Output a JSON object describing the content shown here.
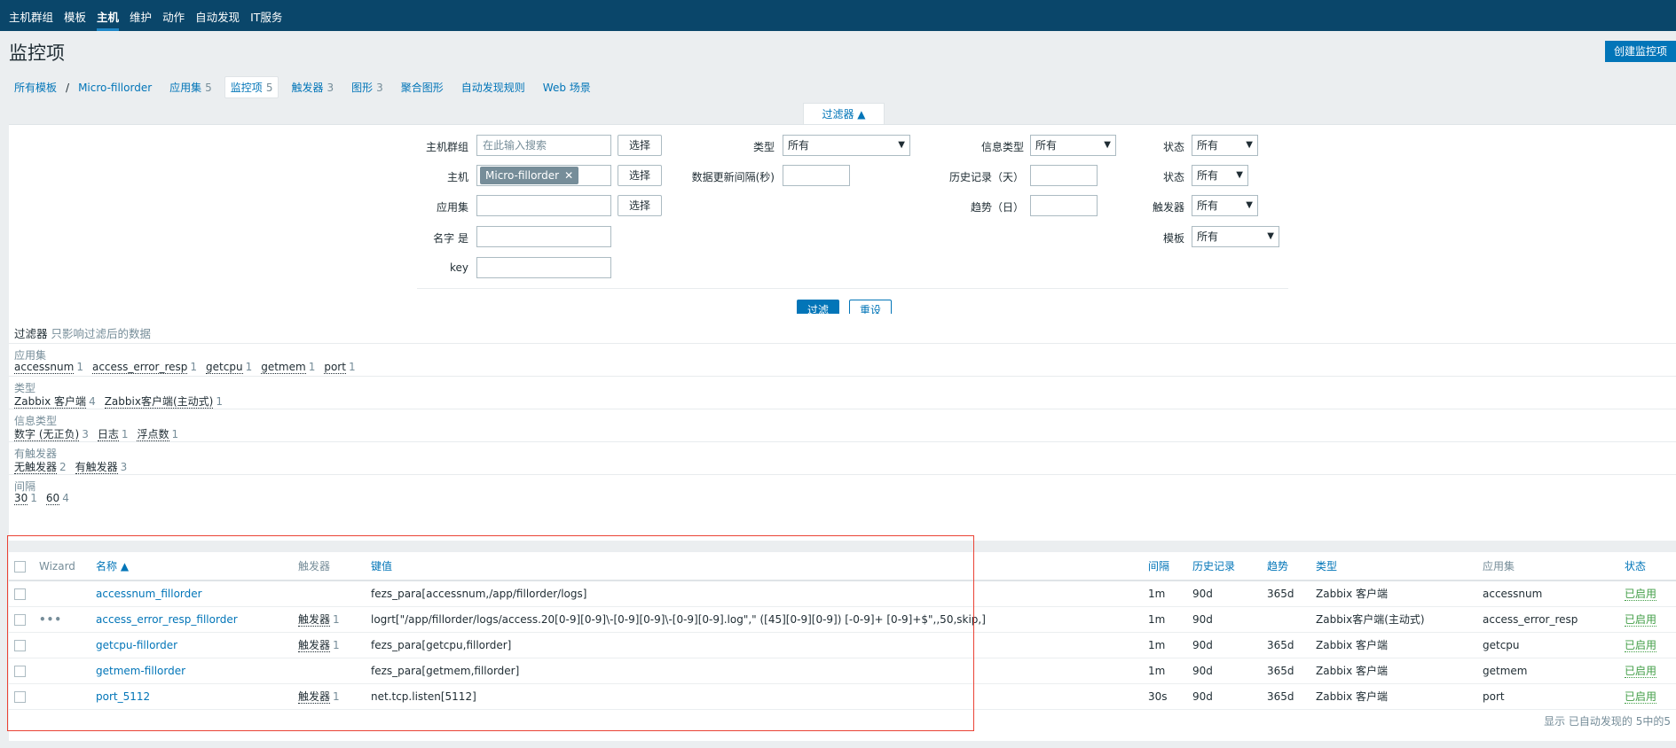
{
  "nav": {
    "tabs": [
      "主机群组",
      "模板",
      "主机",
      "维护",
      "动作",
      "自动发现",
      "IT服务"
    ],
    "active": 2
  },
  "header": {
    "title": "监控项",
    "create_button": "创建监控项"
  },
  "breadcrumbs": [
    {
      "label": "所有模板",
      "count": ""
    },
    {
      "label": "Micro-fillorder",
      "count": ""
    },
    {
      "label": "应用集",
      "count": "5"
    },
    {
      "label": "监控项",
      "count": "5"
    },
    {
      "label": "触发器",
      "count": "3"
    },
    {
      "label": "图形",
      "count": "3"
    },
    {
      "label": "聚合图形",
      "count": ""
    },
    {
      "label": "自动发现规则",
      "count": ""
    },
    {
      "label": "Web 场景",
      "count": ""
    }
  ],
  "filter": {
    "tab_label": "过滤器 ▲",
    "host_group_label": "主机群组",
    "host_group_placeholder": "在此输入搜索",
    "select_button": "选择",
    "host_label": "主机",
    "host_tag": "Micro-fillorder",
    "app_label": "应用集",
    "name_label": "名字 是",
    "key_label": "key",
    "type_label": "类型",
    "type_value": "所有",
    "update_interval_label": "数据更新间隔(秒)",
    "info_type_label": "信息类型",
    "info_type_value": "所有",
    "history_label": "历史记录（天）",
    "trends_label": "趋势（日）",
    "state_label": "状态",
    "state_value": "所有",
    "status_label": "状态",
    "status_value": "所有",
    "triggers_label": "触发器",
    "triggers_value": "所有",
    "template_label": "模板",
    "template_value": "所有",
    "apply_button": "过滤",
    "reset_button": "重设"
  },
  "subfilter": {
    "title": "过滤器",
    "note": "只影响过滤后的数据",
    "groups": [
      {
        "header": "应用集",
        "values": [
          {
            "t": "accessnum",
            "n": "1"
          },
          {
            "t": "access_error_resp",
            "n": "1"
          },
          {
            "t": "getcpu",
            "n": "1"
          },
          {
            "t": "getmem",
            "n": "1"
          },
          {
            "t": "port",
            "n": "1"
          }
        ]
      },
      {
        "header": "类型",
        "values": [
          {
            "t": "Zabbix 客户端",
            "n": "4"
          },
          {
            "t": "Zabbix客户端(主动式)",
            "n": "1"
          }
        ]
      },
      {
        "header": "信息类型",
        "values": [
          {
            "t": "数字 (无正负)",
            "n": "3"
          },
          {
            "t": "日志",
            "n": "1"
          },
          {
            "t": "浮点数",
            "n": "1"
          }
        ]
      },
      {
        "header": "有触发器",
        "values": [
          {
            "t": "无触发器",
            "n": "2"
          },
          {
            "t": "有触发器",
            "n": "3"
          }
        ]
      },
      {
        "header": "间隔",
        "values": [
          {
            "t": "30",
            "n": "1"
          },
          {
            "t": "60",
            "n": "4"
          }
        ]
      }
    ]
  },
  "table": {
    "headers": {
      "wizard": "Wizard",
      "name": "名称 ▲",
      "triggers": "触发器",
      "key": "键值",
      "interval": "间隔",
      "history": "历史记录",
      "trends": "趋势",
      "type": "类型",
      "applications": "应用集",
      "status": "状态"
    },
    "rows": [
      {
        "wizard": "",
        "name": "accessnum_fillorder",
        "triggers": "",
        "trig_n": "",
        "key": "fezs_para[accessnum,/app/fillorder/logs]",
        "interval": "1m",
        "history": "90d",
        "trends": "365d",
        "type": "Zabbix 客户端",
        "application": "accessnum",
        "status": "已启用"
      },
      {
        "wizard": "•••",
        "name": "access_error_resp_fillorder",
        "triggers": "触发器",
        "trig_n": "1",
        "key": "logrt[\"/app/fillorder/logs/access.20[0-9][0-9]\\-[0-9][0-9]\\-[0-9][0-9].log\",\" ([45][0-9][0-9]) [-0-9]+ [0-9]+$\",,50,skip,]",
        "interval": "1m",
        "history": "90d",
        "trends": "",
        "type": "Zabbix客户端(主动式)",
        "application": "access_error_resp",
        "status": "已启用"
      },
      {
        "wizard": "",
        "name": "getcpu-fillorder",
        "triggers": "触发器",
        "trig_n": "1",
        "key": "fezs_para[getcpu,fillorder]",
        "interval": "1m",
        "history": "90d",
        "trends": "365d",
        "type": "Zabbix 客户端",
        "application": "getcpu",
        "status": "已启用"
      },
      {
        "wizard": "",
        "name": "getmem-fillorder",
        "triggers": "",
        "trig_n": "",
        "key": "fezs_para[getmem,fillorder]",
        "interval": "1m",
        "history": "90d",
        "trends": "365d",
        "type": "Zabbix 客户端",
        "application": "getmem",
        "status": "已启用"
      },
      {
        "wizard": "",
        "name": "port_5112",
        "triggers": "触发器",
        "trig_n": "1",
        "key": "net.tcp.listen[5112]",
        "interval": "30s",
        "history": "90d",
        "trends": "365d",
        "type": "Zabbix 客户端",
        "application": "port",
        "status": "已启用"
      }
    ],
    "footer": "显示 已自动发现的 5中的5"
  }
}
